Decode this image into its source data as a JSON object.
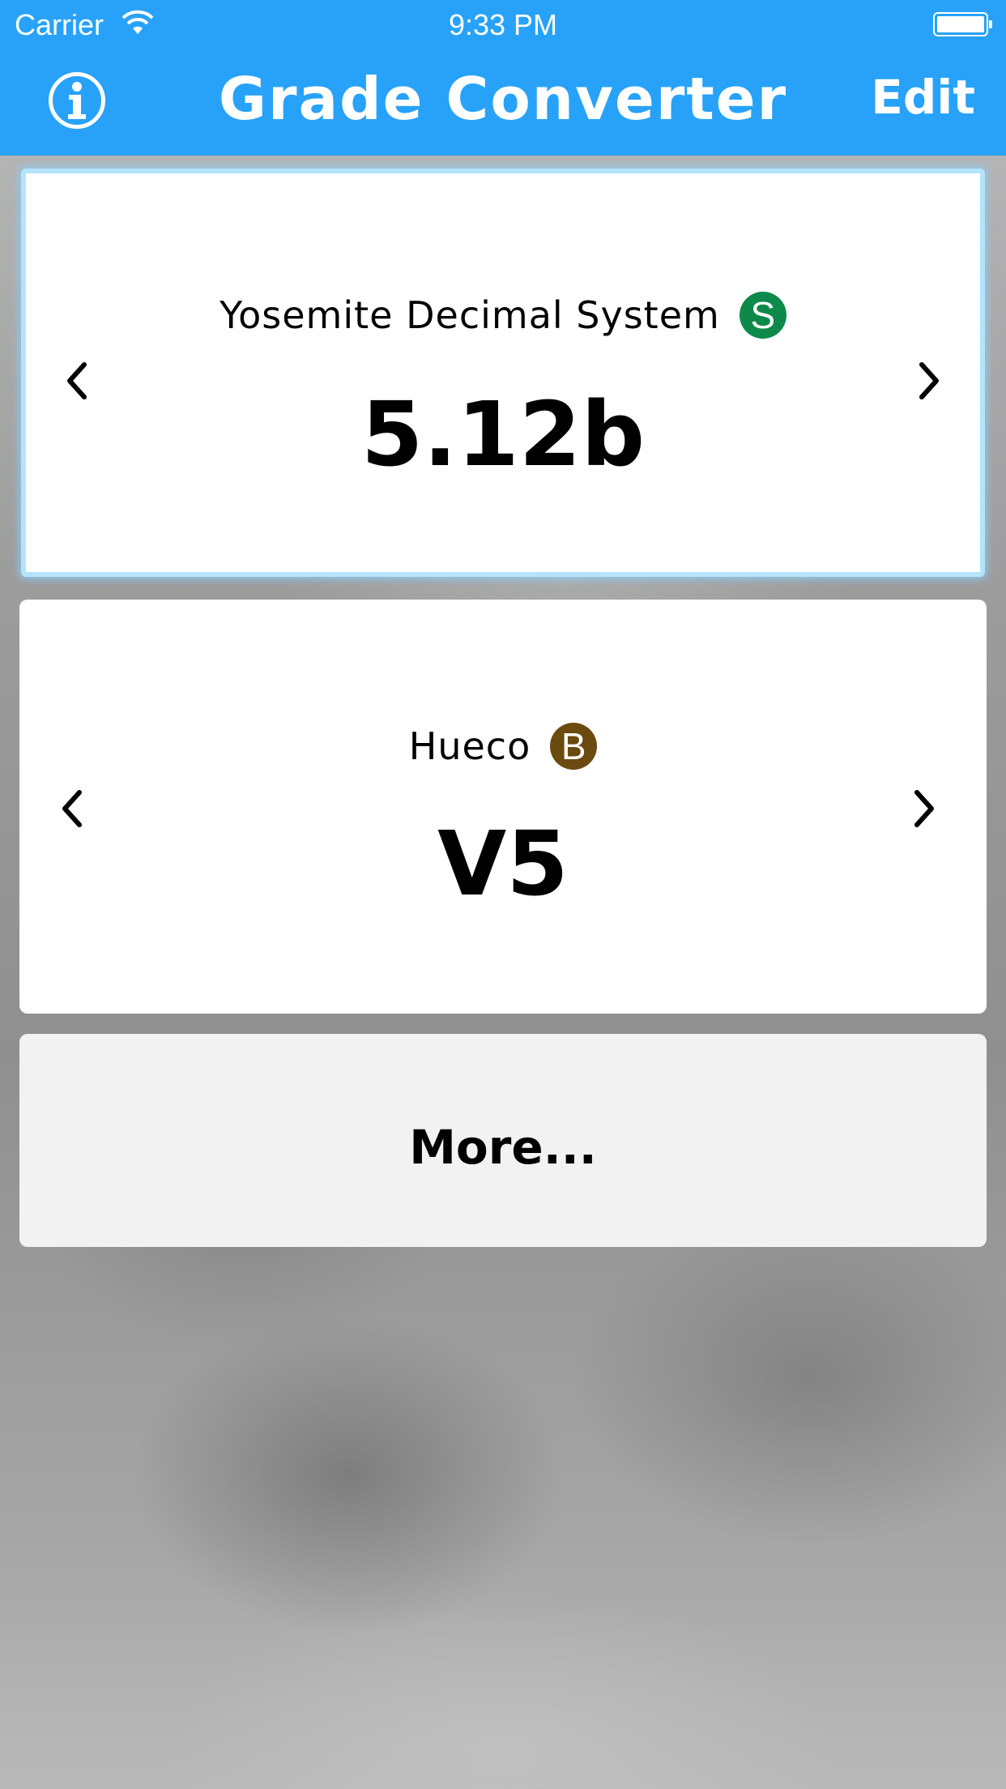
{
  "status_bar": {
    "carrier": "Carrier",
    "time": "9:33 PM"
  },
  "header": {
    "title": "Grade Converter",
    "edit_label": "Edit",
    "info_icon": "info-icon",
    "background_color": "#27a2f8"
  },
  "converters": [
    {
      "system": "Yosemite Decimal System",
      "badge_letter": "S",
      "badge_color": "#0d8a4a",
      "grade": "5.12b",
      "selected": true
    },
    {
      "system": "Hueco",
      "badge_letter": "B",
      "badge_color": "#6b4a10",
      "grade": "V5",
      "selected": false
    }
  ],
  "more_label": "More...",
  "icons": {
    "prev": "chevron-left-icon",
    "next": "chevron-right-icon"
  }
}
